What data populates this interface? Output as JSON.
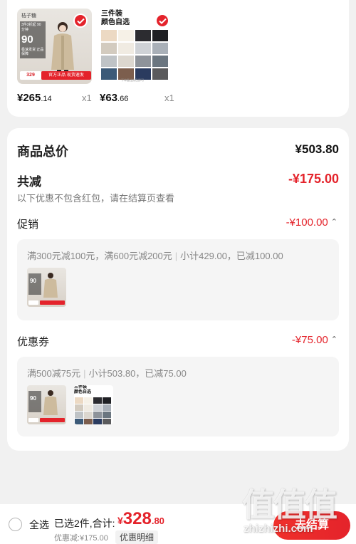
{
  "products": [
    {
      "brand": "桔子糖",
      "promo_line": "3件3折起 90分钟",
      "promo_num": "90",
      "promo_sub": "极速发货 正品保障",
      "thumb_price": "329",
      "ribbon": "官方正品 现货速发",
      "price_int": "¥265",
      "price_dec": ".14",
      "qty": "x1",
      "selected": true
    },
    {
      "swatch_title_1": "三件装",
      "swatch_title_2": "颜色自选",
      "swatch_note": "下单备注颜色即可",
      "swatch_colors": [
        "#ecd9c3",
        "#f6f1e7",
        "#2c2c30",
        "#1f2024",
        "#d3cbbf",
        "#f0ebe2",
        "#cfd2d6",
        "#a9b0b8",
        "#bfc3c6",
        "#dcd7cf",
        "#8e939a",
        "#6b7680",
        "#3c5a78",
        "#7c5e4d",
        "#2a3b5f",
        "#5a5a5c"
      ],
      "price_int": "¥63",
      "price_dec": ".66",
      "qty": "x1",
      "selected": true
    }
  ],
  "summary": {
    "total_label": "商品总价",
    "total_value": "¥503.80",
    "reduce_label": "共减",
    "reduce_value": "-¥175.00",
    "reduce_note": "以下优惠不包含红包，请在结算页查看"
  },
  "promotion": {
    "label": "促销",
    "value": "-¥100.00",
    "rule": "满300元减100元，满600元减200元",
    "subtotal": "小计429.00，已减100.00"
  },
  "coupon": {
    "label": "优惠券",
    "value": "-¥75.00",
    "rule": "满500减75元",
    "subtotal": "小计503.80，已减75.00"
  },
  "bottom": {
    "select_all": "全选",
    "selected_info": "已选2件,合计:",
    "sum_currency": "¥",
    "sum_int": "328",
    "sum_dec": ".80",
    "discount": "优惠减:¥175.00",
    "detail_btn": "优惠明细",
    "checkout": "去结算"
  },
  "watermark": {
    "logo": "值值值",
    "url": "zhizhizhi.com"
  },
  "colors": {
    "accent": "#e4232b",
    "background": "#f1f1f1"
  }
}
